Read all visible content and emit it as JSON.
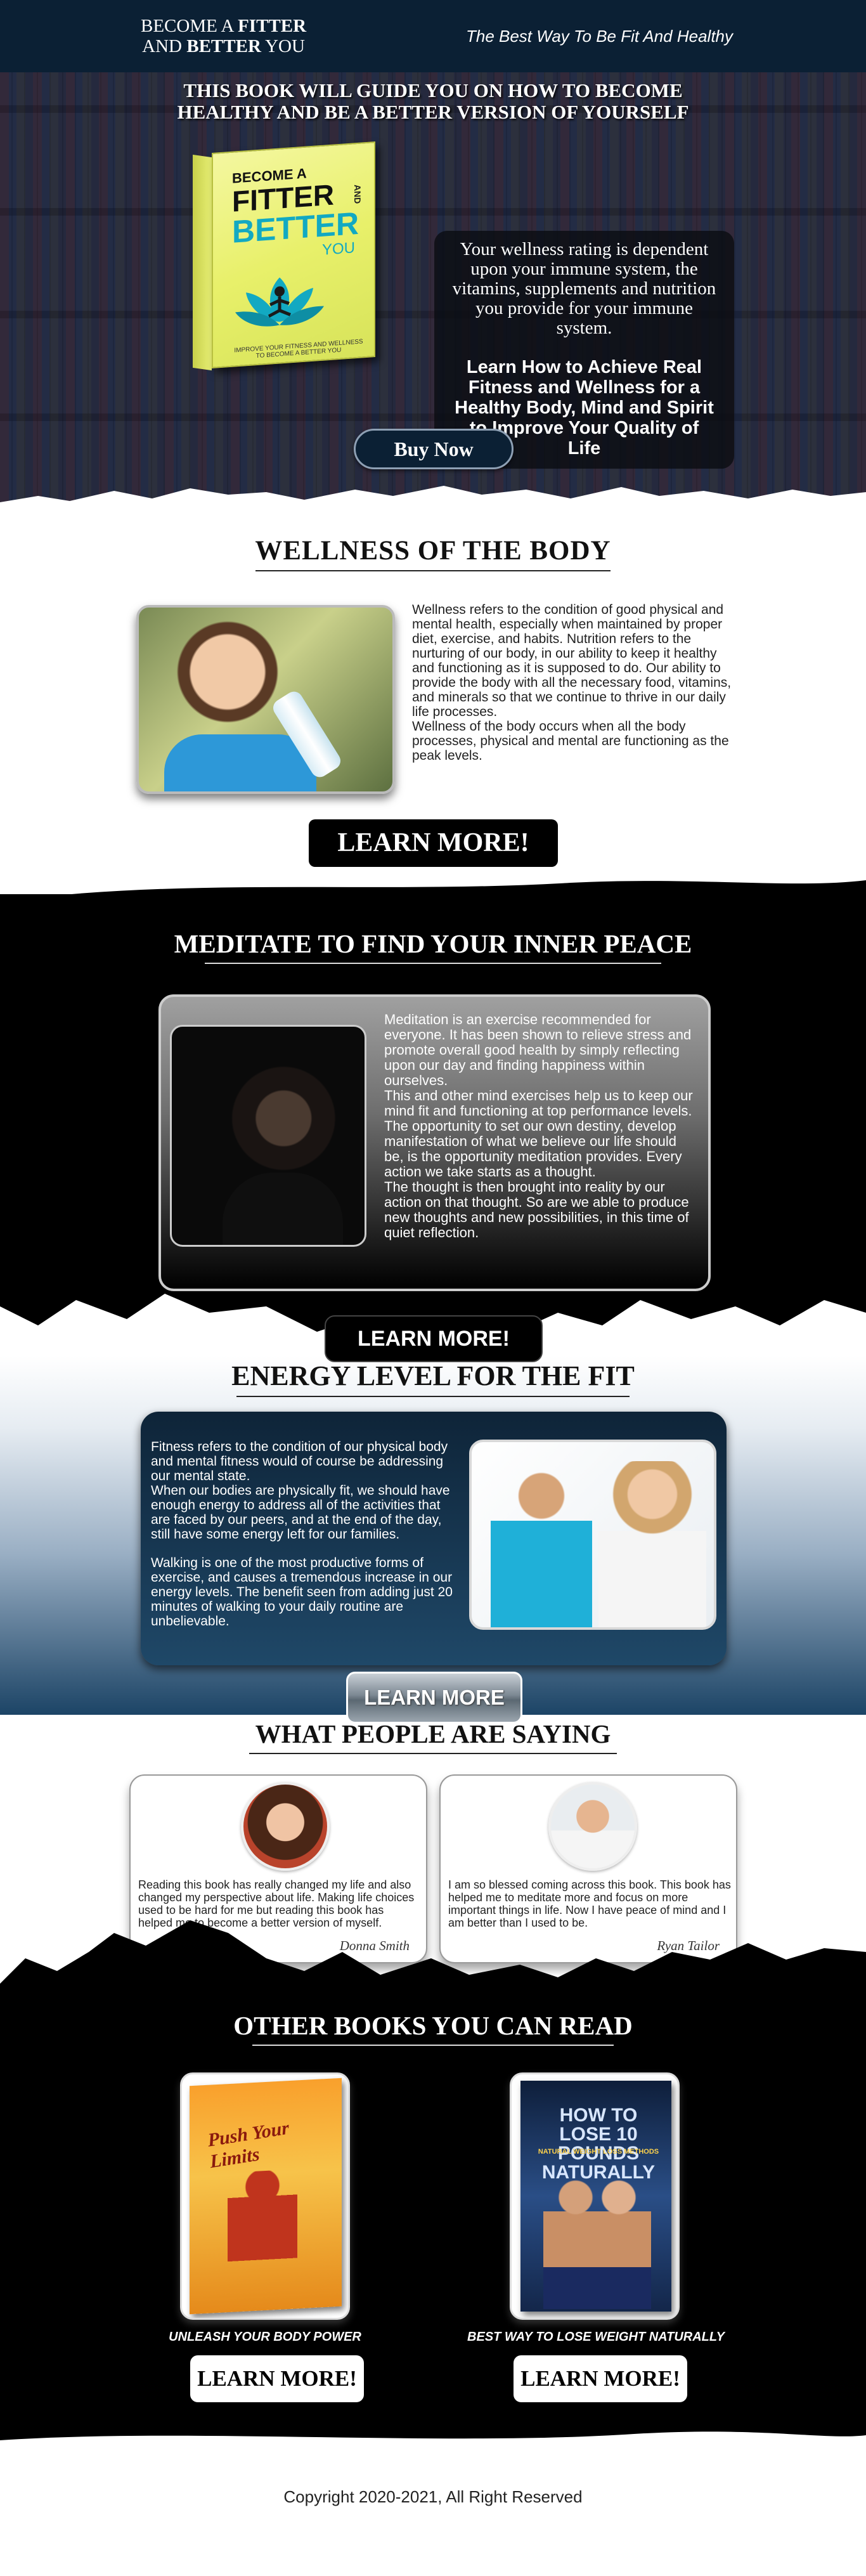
{
  "header": {
    "logo_line1_a": "BECOME A ",
    "logo_line1_b": "FITTER",
    "logo_line2_a": "AND ",
    "logo_line2_b": "BETTER",
    "logo_line2_c": " YOU",
    "tagline": "The Best Way To Be Fit And Healthy"
  },
  "hero": {
    "headline_line1": "THIS BOOK WILL GUIDE YOU ON HOW TO BECOME",
    "headline_line2": "HEALTHY AND BE A BETTER VERSION OF YOURSELF",
    "book": {
      "t1": "BECOME A",
      "t2": "FITTER",
      "and": "AND",
      "t3": "BETTER",
      "t4": "YOU",
      "sub": "IMPROVE YOUR FITNESS AND WELLNESS TO BECOME A BETTER YOU"
    },
    "box_text1": "Your wellness rating is dependent upon your immune system, the vitamins, supplements and nutrition you provide for your immune system.",
    "box_text2": "Learn How to Achieve Real Fitness and Wellness for a Healthy Body, Mind and Spirit to Improve Your Quality of Life",
    "buy_label": "Buy Now"
  },
  "wellness": {
    "title": "WELLNESS OF THE BODY",
    "text1": "Wellness refers to the condition of good physical and mental health, especially when maintained by proper diet, exercise, and habits. Nutrition refers to the nurturing of our body, in our ability to keep it healthy and functioning as it is supposed to do. Our ability to provide the body with all the necessary food, vitamins, and minerals so that we continue to thrive in our daily life processes.",
    "text2": "Wellness of the body occurs when all the body processes, physical and mental are functioning as the peak levels.",
    "button": "LEARN MORE!"
  },
  "meditate": {
    "title": "MEDITATE TO FIND YOUR INNER PEACE",
    "text1": "Meditation is an exercise recommended for everyone. It has been shown to relieve stress and promote overall good health by simply reflecting upon our day and finding happiness within ourselves.",
    "text2": "This and other mind exercises help us to keep our mind fit and functioning at top performance levels.",
    "text3": "The opportunity to set our own destiny, develop manifestation of what we believe our life should be, is the opportunity meditation provides. Every action we  take starts as a thought.",
    "text4": "The thought is then brought into reality by our action on that thought. So are we able to produce new thoughts and new possibilities, in this time of quiet reflection.",
    "button": "LEARN MORE!"
  },
  "energy": {
    "title": "ENERGY LEVEL FOR THE FIT",
    "text1": "Fitness refers to the condition of our physical body and mental fitness would of course be addressing our mental state.",
    "text2": "When our bodies are physically fit, we should have enough energy to address all of the activities that are faced by our peers, and at the end of the day, still have some energy left for our families.",
    "text3": "Walking is one of the most productive forms of exercise, and causes a tremendous increase in our energy levels. The benefit seen from adding just 20 minutes of walking to your daily routine are unbelievable.",
    "button": "LEARN MORE"
  },
  "testimonials": {
    "title": "WHAT PEOPLE ARE SAYING",
    "items": [
      {
        "text": "Reading this book has really changed my life and also changed my perspective about life. Making life choices used to be hard for me but reading this book has helped me to become a better version of myself.",
        "name": "Donna Smith"
      },
      {
        "text": "I am so blessed coming across this book. This book has helped me to meditate more and focus on more important things in life. Now I have peace of mind and I am better than I used to be.",
        "name": "Ryan Tailor"
      }
    ]
  },
  "other_books": {
    "title": "OTHER BOOKS YOU CAN READ",
    "items": [
      {
        "cover_title": "Push Your Limits",
        "caption": "UNLEASH YOUR BODY POWER",
        "button": "LEARN MORE!"
      },
      {
        "cover_title": "HOW TO LOSE 10 POUNDS NATURALLY",
        "cover_sub": "NATURAL WEIGHT LOSS METHODS",
        "caption": "BEST WAY TO LOSE WEIGHT NATURALLY",
        "button": "LEARN MORE!"
      }
    ]
  },
  "footer": {
    "copyright": "Copyright 2020-2021, All Right Reserved"
  },
  "colors": {
    "header_bg": "#0b2034",
    "accent_teal": "#12a9c2",
    "energy_box": "#1f4868"
  }
}
